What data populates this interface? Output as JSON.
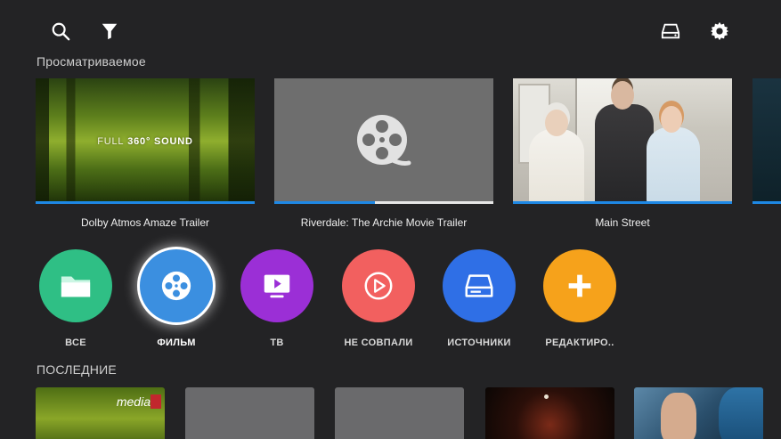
{
  "topbar": {
    "search_icon": "search-icon",
    "filter_icon": "filter-icon",
    "storage_icon": "storage-icon",
    "settings_icon": "gear-icon"
  },
  "watching": {
    "title": "Просматриваемое",
    "items": [
      {
        "label": "Dolby Atmos Amaze Trailer",
        "progress": 1.0,
        "overlay_prefix": "FULL",
        "overlay_main": "360°",
        "overlay_suffix": "SOUND"
      },
      {
        "label": "Riverdale: The Archie Movie Trailer",
        "progress": 0.46
      },
      {
        "label": "Main Street",
        "progress": 1.0
      }
    ]
  },
  "categories": {
    "selected_index": 1,
    "items": [
      {
        "label": "ВСЕ",
        "color": "#2fbf85",
        "icon": "folder-icon"
      },
      {
        "label": "ФИЛЬМ",
        "color": "#3b8fe0",
        "icon": "film-reel-icon"
      },
      {
        "label": "ТВ",
        "color": "#9b2fd6",
        "icon": "tv-play-icon"
      },
      {
        "label": "НЕ СОВПАЛИ",
        "color": "#f2605f",
        "icon": "play-circle-icon"
      },
      {
        "label": "ИСТОЧНИКИ",
        "color": "#2f6fe6",
        "icon": "storage-icon"
      },
      {
        "label": "РЕДАКТИРО..",
        "color": "#f6a21b",
        "icon": "plus-icon"
      }
    ]
  },
  "recent": {
    "title": "ПОСЛЕДНИЕ",
    "media_text": "media"
  },
  "colors": {
    "background": "#232325",
    "progress": "#1e88e5",
    "placeholder": "#6e6e6e"
  }
}
